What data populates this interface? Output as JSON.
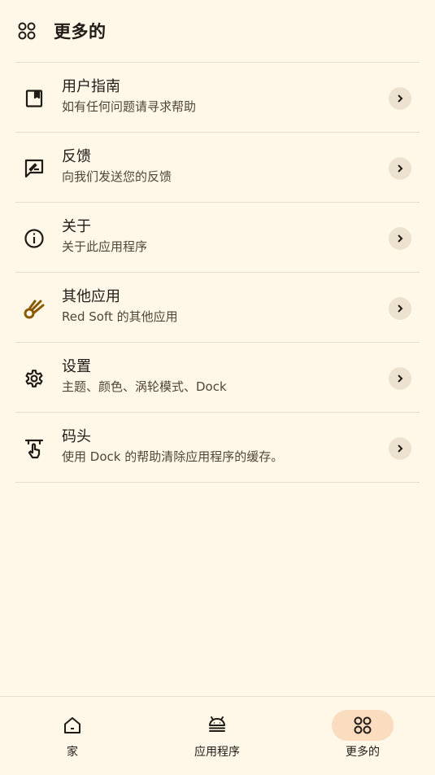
{
  "header": {
    "title": "更多的",
    "icon": "grid-icon"
  },
  "items": [
    {
      "title": "用户指南",
      "subtitle": "如有任何问题请寻求帮助",
      "icon": "book-icon"
    },
    {
      "title": "反馈",
      "subtitle": "向我们发送您的反馈",
      "icon": "feedback-icon"
    },
    {
      "title": "关于",
      "subtitle": "关于此应用程序",
      "icon": "info-icon"
    },
    {
      "title": "其他应用",
      "subtitle": "Red Soft 的其他应用",
      "icon": "comet-icon"
    },
    {
      "title": "设置",
      "subtitle": "主题、颜色、涡轮模式、Dock",
      "icon": "gear-icon"
    },
    {
      "title": "码头",
      "subtitle": "使用 Dock 的帮助清除应用程序的缓存。",
      "icon": "touch-icon"
    }
  ],
  "nav": [
    {
      "label": "家",
      "icon": "home-icon"
    },
    {
      "label": "应用程序",
      "icon": "android-icon"
    },
    {
      "label": "更多的",
      "icon": "grid-icon",
      "active": true
    }
  ],
  "colors": {
    "background": "#fff8e8",
    "divider": "#e4dccd",
    "accent_pill": "#fadcbf",
    "chevron_bg": "#ece2cf",
    "comet_icon": "#8a5a00"
  }
}
